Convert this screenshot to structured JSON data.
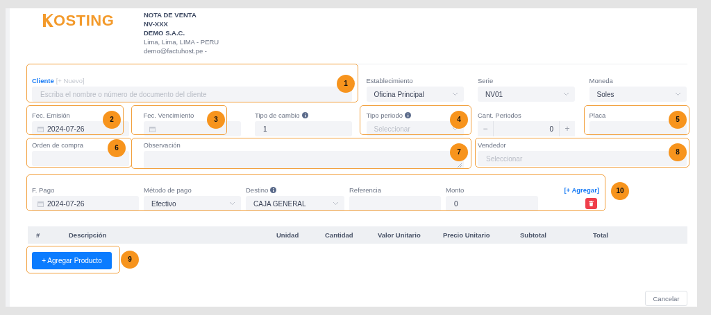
{
  "header": {
    "logo_text": "OSTING",
    "document_type": "NOTA DE VENTA",
    "document_number": "NV-XXX",
    "company": "DEMO S.A.C.",
    "address": "Lima, Lima, LIMA - PERU",
    "email": "demo@factuhost.pe -"
  },
  "form_rows": [
    [
      {
        "kind": "client",
        "label": "Cliente",
        "link": "[+ Nuevo]",
        "placeholder": "Escriba el nombre o número de documento del cliente"
      },
      {
        "kind": "select",
        "label": "Establecimiento",
        "value": "Oficina Principal"
      },
      {
        "kind": "select",
        "label": "Serie",
        "value": "NV01"
      },
      {
        "kind": "select",
        "label": "Moneda",
        "value": "Soles"
      }
    ],
    [
      {
        "kind": "date",
        "label": "Fec. Emisión",
        "value": "2024-07-26"
      },
      {
        "kind": "date",
        "label": "Fec. Vencimiento"
      },
      {
        "kind": "text",
        "label": "Tipo de cambio",
        "info": true,
        "value": "1"
      },
      {
        "kind": "select",
        "label": "Tipo periodo",
        "info": true,
        "placeholder": "Seleccionar"
      },
      {
        "kind": "stepper",
        "label": "Cant. Periodos",
        "value": "0",
        "decrement": "−",
        "increment": "+"
      },
      {
        "kind": "text",
        "label": "Placa"
      }
    ],
    [
      {
        "kind": "text",
        "label": "Orden de compra"
      },
      {
        "kind": "textarea",
        "label": "Observación"
      },
      {
        "kind": "text",
        "label": "Vendedor",
        "placeholder": "Seleccionar"
      }
    ]
  ],
  "payment": {
    "fields": [
      {
        "kind": "date",
        "label": "F. Pago",
        "value": "2024-07-26"
      },
      {
        "kind": "select",
        "label": "Método de pago",
        "value": "Efectivo"
      },
      {
        "kind": "select",
        "label": "Destino",
        "info": true,
        "value": "CAJA GENERAL"
      },
      {
        "kind": "text",
        "label": "Referencia"
      },
      {
        "kind": "text",
        "label": "Monto",
        "value": "0"
      }
    ],
    "add_link": "[+ Agregar]"
  },
  "table": {
    "columns": [
      "#",
      "Descripción",
      "Unidad",
      "Cantidad",
      "Valor Unitario",
      "Precio Unitario",
      "Subtotal",
      "Total"
    ]
  },
  "add_product_button": "+ Agregar Producto",
  "cancel_button": "Cancelar",
  "annotations": [
    {
      "number": "1"
    },
    {
      "number": "2"
    },
    {
      "number": "3"
    },
    {
      "number": "4"
    },
    {
      "number": "5"
    },
    {
      "number": "6"
    },
    {
      "number": "7"
    },
    {
      "number": "8"
    },
    {
      "number": "9"
    },
    {
      "number": "10"
    }
  ]
}
